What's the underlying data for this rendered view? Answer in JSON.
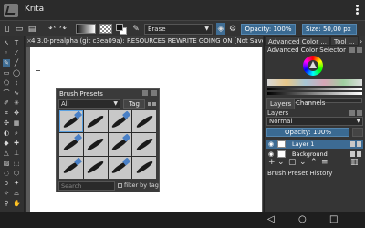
{
  "app": {
    "title": "Krita"
  },
  "toolbar": {
    "blend_mode": "Erase",
    "opacity_label": "Opacity: 100%",
    "size_label": "Size: 50,00 px",
    "swatch_colors": {
      "foreground": "#111111",
      "background": "#ffffff"
    }
  },
  "document": {
    "tab_title": "4.3.0-prealpha (git c3ea09a): RESOURCES REWRITE GOING ON  [Not Saved]  (7,4"
  },
  "brush_presets": {
    "title": "Brush Presets",
    "tag_filter": "All",
    "tag_button": "Tag",
    "search_placeholder": "Search",
    "filter_label": "filter by tag",
    "preset_count": 12
  },
  "right_dock": {
    "tabs": [
      "Advanced Color ...",
      "Tool ..."
    ],
    "color_selector_title": "Advanced Color Selector",
    "layer_tabs": [
      "Layers",
      "Channels"
    ],
    "layers_label": "Layers",
    "composite_mode": "Normal",
    "layer_opacity": "Opacity:  100%",
    "layers": [
      {
        "name": "Layer 1",
        "selected": true
      },
      {
        "name": "Background",
        "selected": false
      }
    ],
    "history_label": "Brush Preset History"
  },
  "colors": {
    "accent": "#3a6a92",
    "panel": "#353535",
    "canvas": "#ffffff"
  }
}
